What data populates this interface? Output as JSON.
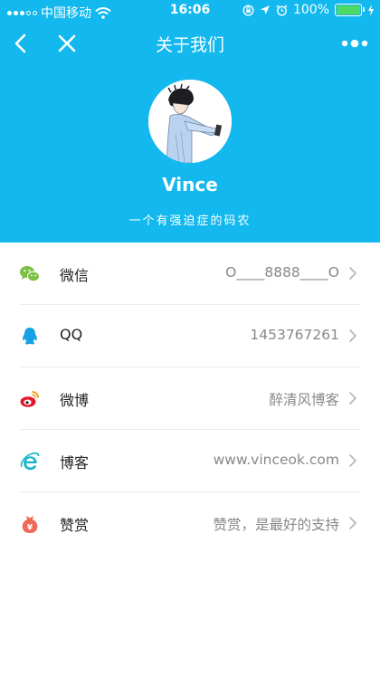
{
  "status_bar": {
    "carrier": "中国移动",
    "time": "16:06",
    "battery": "100%"
  },
  "nav": {
    "title": "关于我们"
  },
  "profile": {
    "name": "Vince",
    "motto": "一个有强迫症的码农"
  },
  "items": [
    {
      "label": "微信",
      "value": "O____8888____O",
      "icon": "wechat-icon",
      "color": "#7bc043"
    },
    {
      "label": "QQ",
      "value": "1453767261",
      "icon": "qq-icon",
      "color": "#16a0e6"
    },
    {
      "label": "微博",
      "value": "醉清风博客",
      "icon": "weibo-icon",
      "color": "#e6162d"
    },
    {
      "label": "博客",
      "value": "www.vinceok.com",
      "icon": "ie-icon",
      "color": "#18b4c8"
    },
    {
      "label": "赞赏",
      "value": "赞赏，是最好的支持",
      "icon": "reward-icon",
      "color": "#f0685a"
    }
  ],
  "colors": {
    "header": "#12b8ee",
    "battery": "#4cd964"
  }
}
